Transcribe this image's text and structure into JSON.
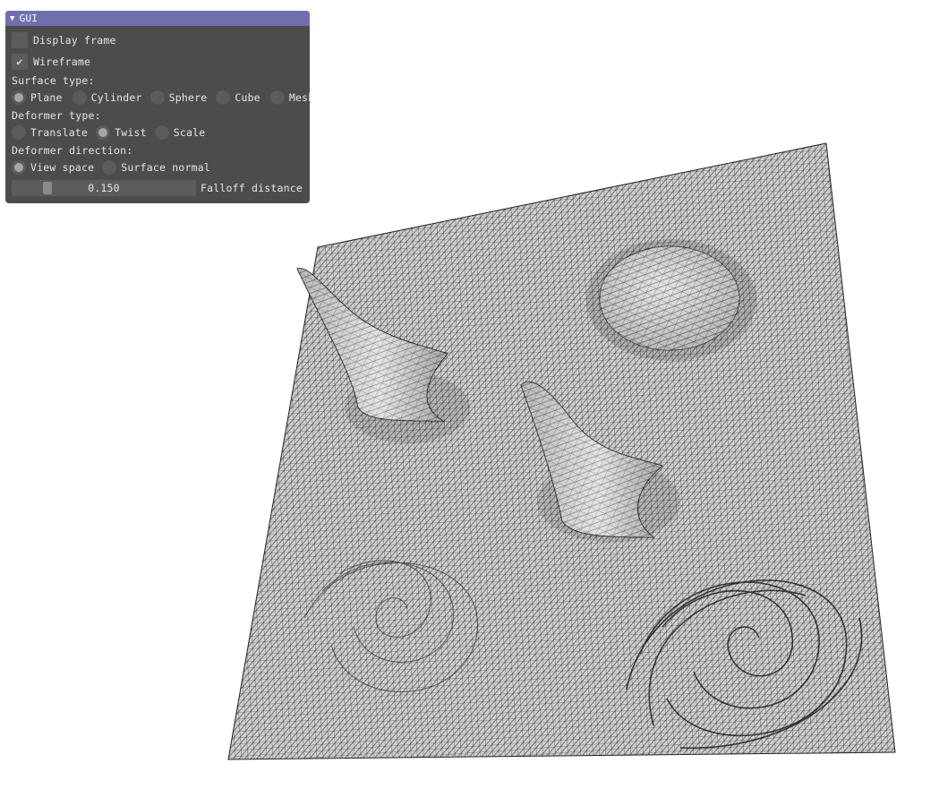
{
  "window": {
    "title": "GUI",
    "collapse_icon": "triangle-down-icon"
  },
  "controls": {
    "display_frame": {
      "label": "Display frame",
      "checked": false
    },
    "wireframe": {
      "label": "Wireframe",
      "checked": true,
      "check_icon": "checkmark-icon"
    },
    "surface_type": {
      "label": "Surface type:",
      "options": [
        "Plane",
        "Cylinder",
        "Sphere",
        "Cube",
        "Mesh"
      ],
      "selected": "Plane"
    },
    "deformer_type": {
      "label": "Deformer type:",
      "options": [
        "Translate",
        "Twist",
        "Scale"
      ],
      "selected": "Twist"
    },
    "deformer_direction": {
      "label": "Deformer direction:",
      "options": [
        "View space",
        "Surface normal"
      ],
      "selected": "View space"
    },
    "falloff": {
      "label": "Falloff distance",
      "value_text": "0.150",
      "value": 0.15
    }
  },
  "scene": {
    "description_icon": "wireframe-surface",
    "colors": {
      "surface": "#c9c9c9",
      "wire": "#1a1a1a",
      "background": "#ffffff"
    }
  }
}
